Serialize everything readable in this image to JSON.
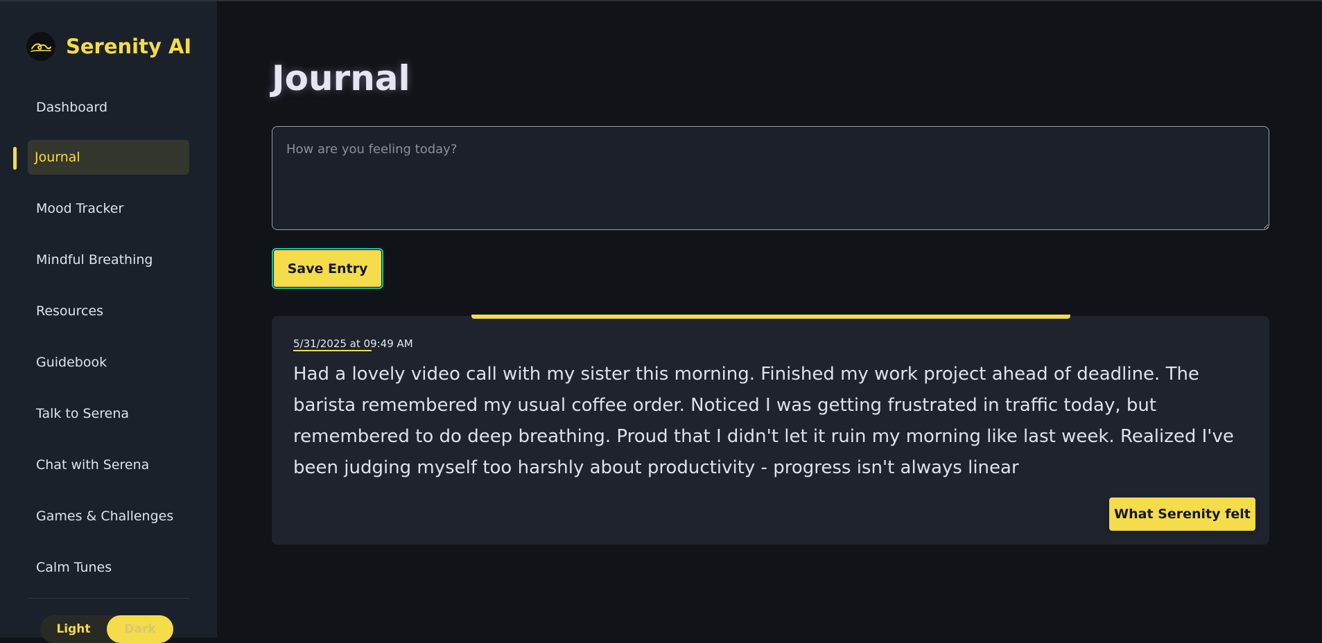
{
  "app": {
    "name": "Serenity AI",
    "logo_icon": "wave-icon"
  },
  "sidebar": {
    "items": [
      {
        "label": "Dashboard"
      },
      {
        "label": "Journal",
        "active": true
      },
      {
        "label": "Mood Tracker"
      },
      {
        "label": "Mindful Breathing"
      },
      {
        "label": "Resources"
      },
      {
        "label": "Guidebook"
      },
      {
        "label": "Talk to Serena"
      },
      {
        "label": "Chat with Serena"
      },
      {
        "label": "Games & Challenges"
      },
      {
        "label": "Calm Tunes"
      }
    ],
    "theme_toggle": {
      "light_label": "Light",
      "dark_label": "Dark",
      "selected": "Dark"
    }
  },
  "main": {
    "title": "Journal",
    "input": {
      "placeholder": "How are you feeling today?",
      "value": ""
    },
    "save_label": "Save Entry",
    "entries": [
      {
        "date": "5/31/2025 at 09:49 AM",
        "text": "Had a lovely video call with my sister this morning. Finished my work project ahead of deadline. The barista remembered my usual coffee order. Noticed I was getting frustrated in traffic today, but remembered to do deep breathing. Proud that I didn't let it ruin my morning like last week. Realized I've been judging myself too harshly about productivity - progress isn't always linear",
        "action_label": "What Serenity felt"
      }
    ]
  },
  "colors": {
    "accent": "#f4dc4a",
    "background": "#101317",
    "sidebar": "#1b212b",
    "card": "#1e232d",
    "focus_ring": "#27b8a6"
  }
}
